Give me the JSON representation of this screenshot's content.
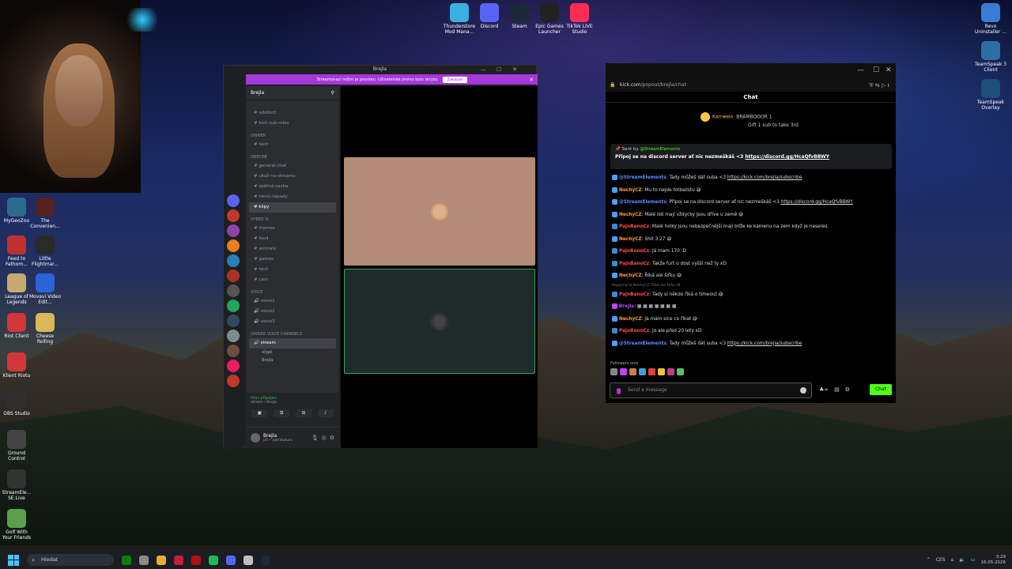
{
  "desktop": {
    "top_icons": [
      {
        "label": "Thunderstore Mod Mana...",
        "color": "#3ab0e0"
      },
      {
        "label": "Discord",
        "color": "#5865f2"
      },
      {
        "label": "Steam",
        "color": "#1b2838"
      },
      {
        "label": "Epic Games Launcher",
        "color": "#222"
      },
      {
        "label": "TikTok LIVE Studio",
        "color": "#fe2c55"
      }
    ],
    "right_icons": [
      {
        "label": "Revo Uninstaller ...",
        "color": "#3a7bd5"
      },
      {
        "label": "TeamSpeak 3 Client",
        "color": "#2d6ea5"
      },
      {
        "label": "TeamSpeak Overlay",
        "color": "#1c4f7a"
      }
    ],
    "left_icons": [
      {
        "label": "MyGeoZoo",
        "color": "#2d6b8a"
      },
      {
        "label": "The Convenien...",
        "color": "#552222"
      },
      {
        "label": "Feed to Fathom...",
        "color": "#c03030"
      },
      {
        "label": "Little Flightmar...",
        "color": "#2a2a2a"
      },
      {
        "label": "League of Legends",
        "color": "#c8aa6e"
      },
      {
        "label": "Movavi Video Edit...",
        "color": "#2b63d8"
      },
      {
        "label": "Riot Client",
        "color": "#d13639"
      },
      {
        "label": "Cheese Rolling",
        "color": "#d8b85a"
      },
      {
        "label": "Klient Riotu",
        "color": "#d13639"
      },
      {
        "label": "OBS Studio",
        "color": "#302e31"
      },
      {
        "label": "Ground Control",
        "color": "#444"
      },
      {
        "label": "StreamEle... SE.Live",
        "color": "#333"
      },
      {
        "label": "Golf With Your Friends",
        "color": "#5aa04a"
      }
    ]
  },
  "discord": {
    "title": "Brejla",
    "banner_text": "Streamovací režim je povolen. Uživatelské jméno bylo skryto.",
    "banner_button": "Zakázat",
    "guild_name": "Brejla",
    "channels": [
      {
        "type": "cat",
        "label": ""
      },
      {
        "type": "ch",
        "label": "# oddíloct"
      },
      {
        "type": "ch",
        "label": "# kick-sub-roles"
      },
      {
        "type": "cat",
        "label": "OWNER"
      },
      {
        "type": "ch",
        "label": "# tech"
      },
      {
        "type": "cat",
        "label": "OBECNÉ"
      },
      {
        "type": "ch",
        "label": "# general-chat"
      },
      {
        "type": "ch",
        "label": "# ukaž-na-streamu"
      },
      {
        "type": "ch",
        "label": "# zpětná-vazba"
      },
      {
        "type": "ch",
        "label": "# herní-nápady"
      },
      {
        "type": "ch-active",
        "label": "# klipy"
      },
      {
        "type": "cat",
        "label": "VYBER SI"
      },
      {
        "type": "ch",
        "label": "# memes"
      },
      {
        "type": "ch",
        "label": "# food"
      },
      {
        "type": "ch",
        "label": "# animals"
      },
      {
        "type": "ch",
        "label": "# games"
      },
      {
        "type": "ch",
        "label": "# tech"
      },
      {
        "type": "ch",
        "label": "# cars"
      },
      {
        "type": "cat",
        "label": "VOICE"
      },
      {
        "type": "ch",
        "label": "🔊 voice1"
      },
      {
        "type": "ch",
        "label": "🔊 voice2"
      },
      {
        "type": "ch",
        "label": "🔊 voice3"
      },
      {
        "type": "cat",
        "label": "OWNER VOICE CHANNELS"
      },
      {
        "type": "ch-active",
        "label": "🔊 stream"
      },
      {
        "type": "user",
        "label": "aligel"
      },
      {
        "type": "user",
        "label": "Brejla"
      }
    ],
    "voice_status": "Hlas připojen",
    "voice_sub": "stream / Brejla",
    "user_name": "Brejla",
    "user_sub": "při • patrolutura"
  },
  "kick": {
    "url_host": "kick.com",
    "url_path": "/popout/brejla/chat",
    "header": "Chat",
    "gift": {
      "user": "Karrwein",
      "target": "BRAMBOOOR",
      "count": "1",
      "text": "Gift 1 sub to take 3rd"
    },
    "pinned": {
      "sent_by_label": "Sent by",
      "sent_by_user": "@StreamElements",
      "text": "Připoj se na discord server ať nic nezmeškáš <3",
      "link": "https://discord.gg/HcaQfvBBWY"
    },
    "messages": [
      {
        "user": "@StreamElements",
        "color": "#5b8cff",
        "text": ": Tady můžeš dát suba <3 ",
        "link": "https://kick.com/brejla/subscribe",
        "badge": "#4aa0ff"
      },
      {
        "user": "NechyCZ",
        "color": "#ff9a3a",
        "text": ": Mu to nejde fotbalistu 😅",
        "link": "",
        "badge": "#4aa0ff"
      },
      {
        "user": "@StreamElements",
        "color": "#5b8cff",
        "text": ": Připoj se na discord server ať nic nezmeškáš <3 ",
        "link": "https://discord.gg/HcaQfvBBWY",
        "badge": "#4aa0ff"
      },
      {
        "user": "NechyCZ",
        "color": "#ff9a3a",
        "text": ": Malé lidi mají vždycky jsou dříve u země 😅",
        "link": "",
        "badge": "#4aa0ff"
      },
      {
        "user": "PajnBanoCz",
        "color": "#ff4d4d",
        "text": ": Malé holky jsou nebezpečnější mají blíže ke kamenu na zem když je naseres",
        "link": "",
        "badge": "#3a8ad8"
      },
      {
        "user": "NechyCZ",
        "color": "#ff9a3a",
        "text": ": Shit 3:27 😅",
        "link": "",
        "badge": "#4aa0ff"
      },
      {
        "user": "PajnBanoCz",
        "color": "#ff4d4d",
        "text": ": Já mam 170 :D",
        "link": "",
        "badge": "#3a8ad8"
      },
      {
        "user": "PajnBanoCz",
        "color": "#ff4d4d",
        "text": ": Takže furt o dost vyšší než ty xD",
        "link": "",
        "badge": "#3a8ad8"
      },
      {
        "user": "NechyCZ",
        "color": "#ff9a3a",
        "text": ": Říká ale šiřku 😅",
        "link": "",
        "badge": "#4aa0ff"
      },
      {
        "user": "PajnBanoCz",
        "color": "#ff4d4d",
        "text": ": Tady si někdo říká o timeout 😅",
        "link": "",
        "badge": "#3a8ad8",
        "reply": "Replying to NechyCZ: Říká ale šiřku 😅"
      },
      {
        "user": "Brejla",
        "color": "#c042ff",
        "text": ": ▦ ▦ ▦ ▦ ▦ ▦ ▦",
        "link": "",
        "badge": "#c042ff"
      },
      {
        "user": "NechyCZ",
        "color": "#ff9a3a",
        "text": ": Já mám sice co říkat 😅",
        "link": "",
        "badge": "#4aa0ff"
      },
      {
        "user": "PajnBanoCz",
        "color": "#ff4d4d",
        "text": ": Jo ale před 20 lety xD",
        "link": "",
        "badge": "#3a8ad8"
      },
      {
        "user": "@StreamElements",
        "color": "#5b8cff",
        "text": ": Tady můžeš dát suba <3 ",
        "link": "https://kick.com/brejla/subscribe",
        "badge": "#4aa0ff"
      }
    ],
    "followers_only": "Followers only",
    "input_placeholder": "Send a message",
    "send_label": "Chat"
  },
  "taskbar": {
    "search_placeholder": "Hledat",
    "lang": "CES",
    "time": "3:29",
    "date": "16.05.2026"
  }
}
